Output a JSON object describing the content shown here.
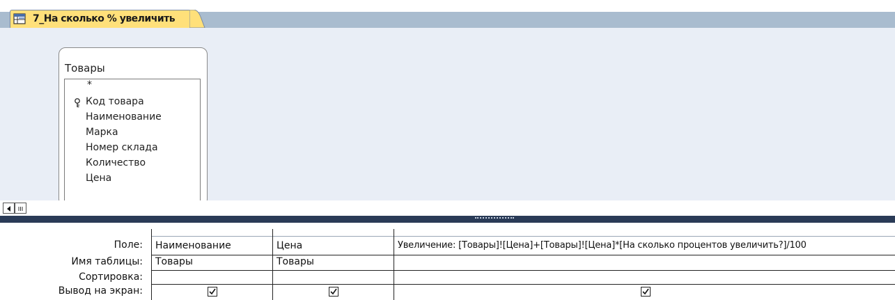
{
  "tab": {
    "title": "7_На сколько % увеличить",
    "icon": "query-icon"
  },
  "table_window": {
    "title": "Товары",
    "fields": [
      "*",
      "Код товара",
      "Наименование",
      "Марка",
      "Номер склада",
      "Количество",
      "Цена"
    ],
    "key_field_icon": "primary-key-icon"
  },
  "design_grid": {
    "row_labels": {
      "field": "Поле:",
      "table": "Имя таблицы:",
      "sort": "Сортировка:",
      "show": "Вывод на экран:"
    },
    "columns": [
      {
        "field": "Наименование",
        "table": "Товары",
        "sort": "",
        "show": true
      },
      {
        "field": "Цена",
        "table": "Товары",
        "sort": "",
        "show": true
      },
      {
        "field": "Увеличение: [Товары]![Цена]+[Товары]![Цена]*[На сколько процентов увеличить?]/100",
        "table": "",
        "sort": "",
        "show": true
      }
    ]
  },
  "colors": {
    "tab_active": "#ffe07a",
    "tab_strip": "#a9bccf",
    "upper_pane": "#e9eef6",
    "splitter": "#2a3b57"
  }
}
